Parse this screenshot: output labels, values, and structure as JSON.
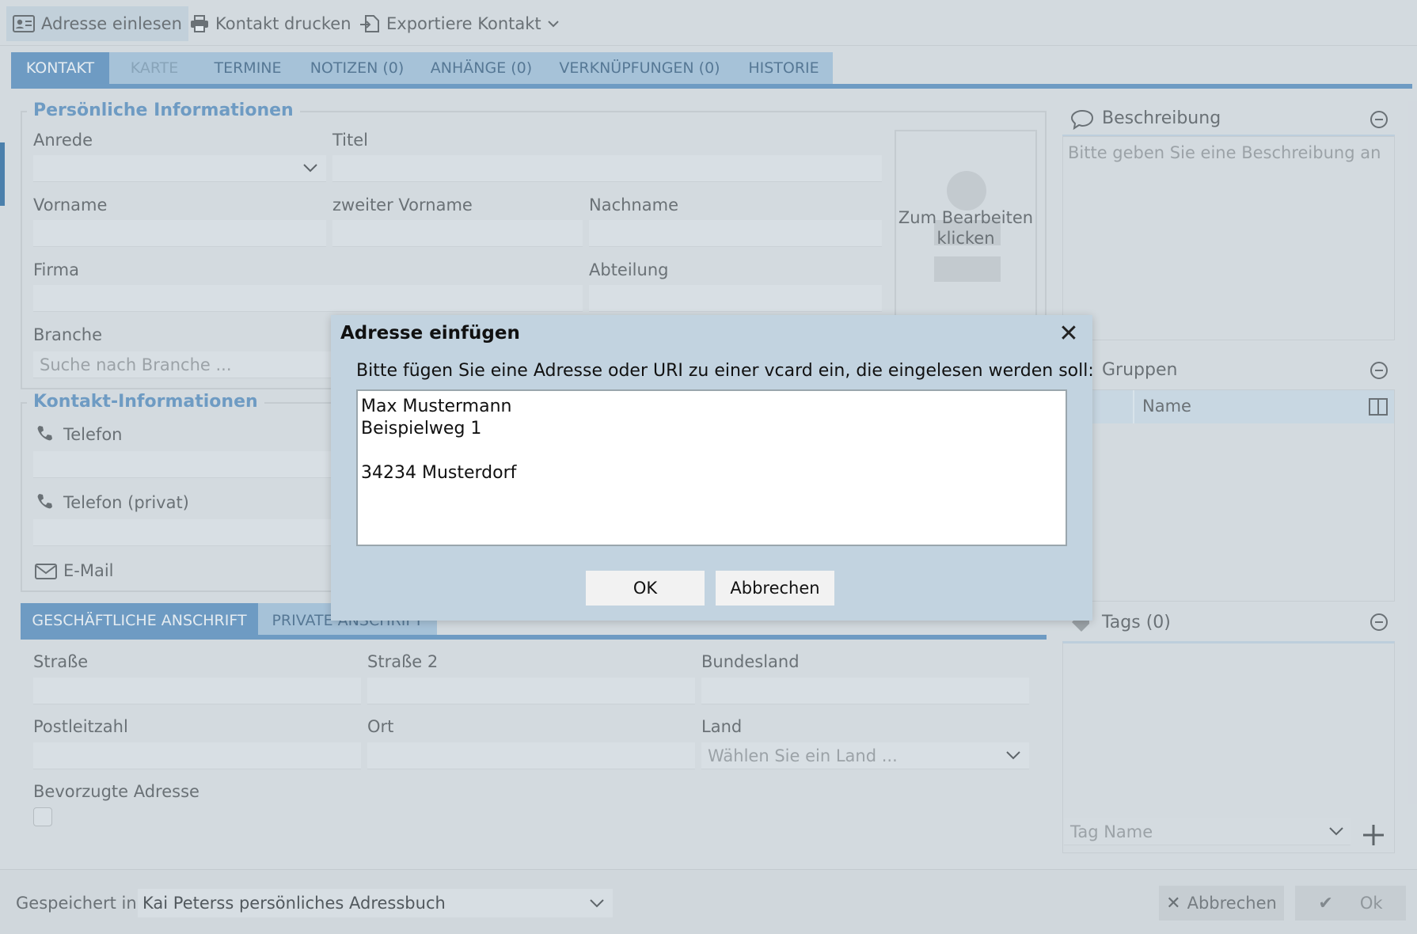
{
  "toolbar": {
    "read_address": "Adresse einlesen",
    "print_contact": "Kontakt drucken",
    "export_contact": "Exportiere Kontakt"
  },
  "tabs": [
    {
      "label": "KONTAKT",
      "state": "active"
    },
    {
      "label": "KARTE",
      "state": "disabled"
    },
    {
      "label": "TERMINE",
      "state": "normal"
    },
    {
      "label": "NOTIZEN (0)",
      "state": "normal"
    },
    {
      "label": "ANHÄNGE (0)",
      "state": "normal"
    },
    {
      "label": "VERKNÜPFUNGEN (0)",
      "state": "normal"
    },
    {
      "label": "HISTORIE",
      "state": "normal"
    }
  ],
  "personal": {
    "legend": "Persönliche Informationen",
    "salutation_label": "Anrede",
    "title_label": "Titel",
    "first_name_label": "Vorname",
    "middle_name_label": "zweiter Vorname",
    "last_name_label": "Nachname",
    "company_label": "Firma",
    "department_label": "Abteilung",
    "industry_label": "Branche",
    "industry_placeholder": "Suche nach Branche ...",
    "photo_caption": "Zum Bearbeiten klicken"
  },
  "contact_info": {
    "legend": "Kontakt-Informationen",
    "phone_label": "Telefon",
    "phone_private_label": "Telefon (privat)",
    "email_label": "E-Mail"
  },
  "address_tabs": {
    "business": "GESCHÄFTLICHE ANSCHRIFT",
    "private": "PRIVATE ANSCHRIFT"
  },
  "address": {
    "street_label": "Straße",
    "street2_label": "Straße 2",
    "state_label": "Bundesland",
    "zip_label": "Postleitzahl",
    "city_label": "Ort",
    "country_label": "Land",
    "country_placeholder": "Wählen Sie ein Land ...",
    "preferred_label": "Bevorzugte Adresse"
  },
  "description": {
    "title": "Beschreibung",
    "placeholder": "Bitte geben Sie eine Beschreibung an"
  },
  "groups": {
    "title": "Gruppen",
    "col_name": "Name"
  },
  "tags": {
    "title": "Tags (0)",
    "placeholder": "Tag Name"
  },
  "footer": {
    "saved_in_label": "Gespeichert in",
    "addressbook": "Kai Peterss persönliches Adressbuch",
    "cancel": "Abbrechen",
    "ok": "Ok"
  },
  "dialog": {
    "title": "Adresse einfügen",
    "prompt": "Bitte fügen Sie eine Adresse oder URI zu einer vcard ein, die eingelesen werden soll:",
    "text": "Max Mustermann\nBeispielweg 1\n\n34234 Musterdorf",
    "ok": "OK",
    "cancel": "Abbrechen"
  },
  "colors": {
    "accent": "#5b8fbf",
    "tab_inactive": "#a8c5dd",
    "dialog_bg": "#c2d3e0"
  }
}
